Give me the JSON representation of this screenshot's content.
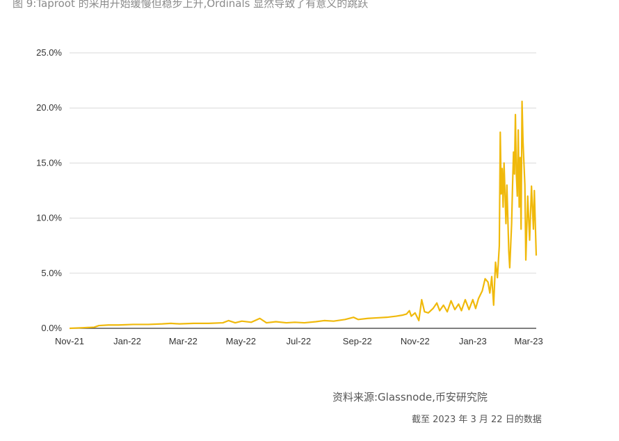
{
  "caption": "图 9:Taproot 的采用开始缓慢但稳步上升,Ordinals 显然导致了有意义的跳跃",
  "source": "资料来源:Glassnode,币安研究院",
  "as_of": "截至 2023 年 3 月 22 日的数据",
  "colors": {
    "line": "#F0B90B",
    "grid": "#D9D9D9",
    "axis": "#333333"
  },
  "chart_data": {
    "type": "line",
    "title": "",
    "xlabel": "",
    "ylabel": "",
    "y_unit": "%",
    "ylim": [
      0,
      25
    ],
    "yticks": [
      {
        "value": 0,
        "label": "0.0%"
      },
      {
        "value": 5,
        "label": "5.0%"
      },
      {
        "value": 10,
        "label": "10.0%"
      },
      {
        "value": 15,
        "label": "15.0%"
      },
      {
        "value": 20,
        "label": "20.0%"
      },
      {
        "value": 25,
        "label": "25.0%"
      }
    ],
    "xlim": [
      "2021-11-14",
      "2023-03-22"
    ],
    "xticks": [
      {
        "value": "2021-11-14",
        "label": "Nov-21"
      },
      {
        "value": "2022-01-14",
        "label": "Jan-22"
      },
      {
        "value": "2022-03-14",
        "label": "Mar-22"
      },
      {
        "value": "2022-05-14",
        "label": "May-22"
      },
      {
        "value": "2022-07-14",
        "label": "Jul-22"
      },
      {
        "value": "2022-09-14",
        "label": "Sep-22"
      },
      {
        "value": "2022-11-14",
        "label": "Nov-22"
      },
      {
        "value": "2023-01-14",
        "label": "Jan-23"
      },
      {
        "value": "2023-03-14",
        "label": "Mar-23"
      }
    ],
    "grid": true,
    "legend": "none",
    "series": [
      {
        "points": [
          [
            "2021-11-14",
            0.0
          ],
          [
            "2021-11-28",
            0.05
          ],
          [
            "2021-12-10",
            0.1
          ],
          [
            "2021-12-15",
            0.25
          ],
          [
            "2021-12-25",
            0.3
          ],
          [
            "2022-01-05",
            0.3
          ],
          [
            "2022-01-20",
            0.35
          ],
          [
            "2022-02-05",
            0.35
          ],
          [
            "2022-02-20",
            0.4
          ],
          [
            "2022-03-01",
            0.45
          ],
          [
            "2022-03-10",
            0.4
          ],
          [
            "2022-03-25",
            0.45
          ],
          [
            "2022-04-10",
            0.45
          ],
          [
            "2022-04-25",
            0.5
          ],
          [
            "2022-05-01",
            0.7
          ],
          [
            "2022-05-08",
            0.5
          ],
          [
            "2022-05-15",
            0.65
          ],
          [
            "2022-05-25",
            0.55
          ],
          [
            "2022-06-03",
            0.9
          ],
          [
            "2022-06-10",
            0.5
          ],
          [
            "2022-06-20",
            0.6
          ],
          [
            "2022-07-01",
            0.5
          ],
          [
            "2022-07-10",
            0.55
          ],
          [
            "2022-07-20",
            0.5
          ],
          [
            "2022-08-01",
            0.6
          ],
          [
            "2022-08-10",
            0.7
          ],
          [
            "2022-08-20",
            0.65
          ],
          [
            "2022-09-01",
            0.8
          ],
          [
            "2022-09-10",
            1.0
          ],
          [
            "2022-09-15",
            0.8
          ],
          [
            "2022-09-25",
            0.9
          ],
          [
            "2022-10-05",
            0.95
          ],
          [
            "2022-10-15",
            1.0
          ],
          [
            "2022-10-25",
            1.1
          ],
          [
            "2022-11-01",
            1.2
          ],
          [
            "2022-11-05",
            1.3
          ],
          [
            "2022-11-08",
            1.6
          ],
          [
            "2022-11-10",
            1.1
          ],
          [
            "2022-11-14",
            1.4
          ],
          [
            "2022-11-18",
            0.7
          ],
          [
            "2022-11-21",
            2.6
          ],
          [
            "2022-11-24",
            1.5
          ],
          [
            "2022-11-28",
            1.4
          ],
          [
            "2022-12-03",
            1.8
          ],
          [
            "2022-12-07",
            2.3
          ],
          [
            "2022-12-10",
            1.6
          ],
          [
            "2022-12-14",
            2.1
          ],
          [
            "2022-12-18",
            1.5
          ],
          [
            "2022-12-22",
            2.5
          ],
          [
            "2022-12-26",
            1.7
          ],
          [
            "2022-12-30",
            2.2
          ],
          [
            "2023-01-02",
            1.6
          ],
          [
            "2023-01-06",
            2.6
          ],
          [
            "2023-01-10",
            1.7
          ],
          [
            "2023-01-14",
            2.6
          ],
          [
            "2023-01-17",
            1.8
          ],
          [
            "2023-01-20",
            2.7
          ],
          [
            "2023-01-24",
            3.4
          ],
          [
            "2023-01-27",
            4.5
          ],
          [
            "2023-01-30",
            4.2
          ],
          [
            "2023-02-01",
            3.2
          ],
          [
            "2023-02-03",
            4.7
          ],
          [
            "2023-02-05",
            2.1
          ],
          [
            "2023-02-07",
            6.0
          ],
          [
            "2023-02-09",
            4.6
          ],
          [
            "2023-02-11",
            7.5
          ],
          [
            "2023-02-12",
            17.8
          ],
          [
            "2023-02-13",
            12.2
          ],
          [
            "2023-02-14",
            14.5
          ],
          [
            "2023-02-15",
            11.0
          ],
          [
            "2023-02-16",
            15.0
          ],
          [
            "2023-02-18",
            9.5
          ],
          [
            "2023-02-19",
            13.0
          ],
          [
            "2023-02-21",
            7.0
          ],
          [
            "2023-02-22",
            5.5
          ],
          [
            "2023-02-23",
            7.5
          ],
          [
            "2023-02-24",
            9.5
          ],
          [
            "2023-02-25",
            13.0
          ],
          [
            "2023-02-26",
            16.0
          ],
          [
            "2023-02-27",
            14.0
          ],
          [
            "2023-02-28",
            19.4
          ],
          [
            "2023-03-01",
            14.0
          ],
          [
            "2023-03-02",
            12.0
          ],
          [
            "2023-03-03",
            18.0
          ],
          [
            "2023-03-04",
            11.0
          ],
          [
            "2023-03-05",
            15.5
          ],
          [
            "2023-03-06",
            9.0
          ],
          [
            "2023-03-07",
            20.6
          ],
          [
            "2023-03-08",
            17.0
          ],
          [
            "2023-03-10",
            13.0
          ],
          [
            "2023-03-11",
            6.2
          ],
          [
            "2023-03-13",
            12.0
          ],
          [
            "2023-03-15",
            8.0
          ],
          [
            "2023-03-17",
            12.9
          ],
          [
            "2023-03-19",
            9.0
          ],
          [
            "2023-03-20",
            12.5
          ],
          [
            "2023-03-22",
            6.6
          ]
        ]
      }
    ]
  }
}
